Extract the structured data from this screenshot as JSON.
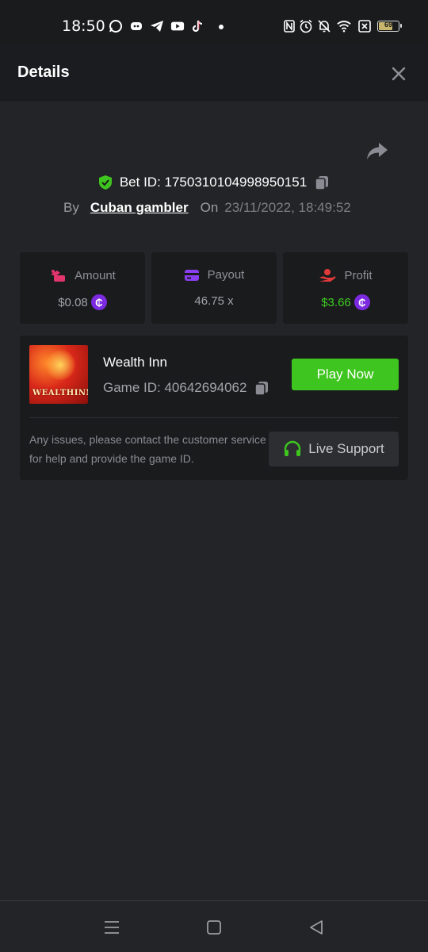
{
  "status_bar": {
    "time": "18:50",
    "battery_level": "69",
    "app_icons": [
      "whatsapp-icon",
      "discord-icon",
      "telegram-icon",
      "youtube-icon",
      "tiktok-icon"
    ],
    "system_icons": [
      "nfc-icon",
      "alarm-icon",
      "mute-icon",
      "wifi-icon",
      "no-sim-icon"
    ]
  },
  "header": {
    "title": "Details"
  },
  "bet": {
    "id_label": "Bet ID: 1750310104998950151",
    "by_label": "By",
    "username": "Cuban gambler",
    "on_label": "On",
    "datetime": "23/11/2022, 18:49:52"
  },
  "stats": {
    "amount": {
      "label": "Amount",
      "value": "$0.08"
    },
    "payout": {
      "label": "Payout",
      "value": "46.75 x"
    },
    "profit": {
      "label": "Profit",
      "value": "$3.66"
    }
  },
  "game": {
    "name": "Wealth Inn",
    "id_label": "Game ID: 40642694062",
    "thumb_text": "WEALTHINN",
    "play_label": "Play Now",
    "help_text": "Any issues, please contact the customer service for help and provide the game ID.",
    "support_label": "Live Support"
  },
  "colors": {
    "background": "#232427",
    "panel": "#1a1b1d",
    "accent_green": "#3fc51f",
    "coin_purple": "#7c2ae0",
    "shield_green": "#3fc51f"
  }
}
